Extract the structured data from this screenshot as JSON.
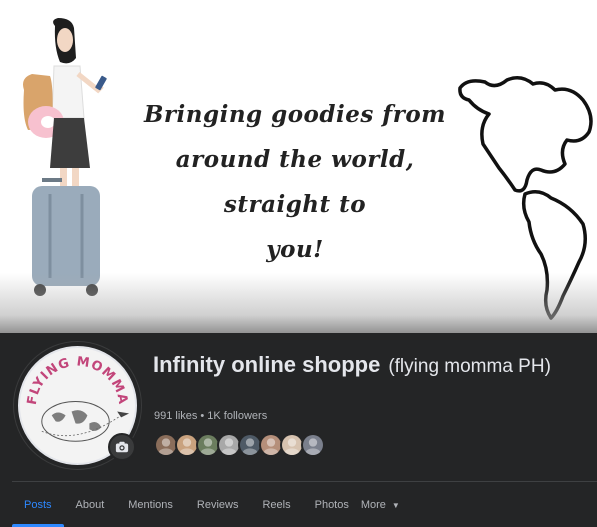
{
  "cover": {
    "tagline_lines": [
      "Bringing goodies from",
      "around the world, straight to",
      "you!"
    ]
  },
  "page": {
    "name": "Infinity online shoppe",
    "alt_name": "(flying momma PH)",
    "likes": "991 likes",
    "separator": "•",
    "followers": "1K followers"
  },
  "avatar": {
    "logo_text": "FLYING MOMMA"
  },
  "friends": {
    "colors": [
      "#8a6d5a",
      "#c9a27e",
      "#6b7d5e",
      "#a8a8a8",
      "#4e5a66",
      "#b58f7a",
      "#d7c3b0",
      "#7a7f8c"
    ]
  },
  "tabs": [
    {
      "label": "Posts",
      "active": true
    },
    {
      "label": "About"
    },
    {
      "label": "Mentions"
    },
    {
      "label": "Reviews"
    },
    {
      "label": "Reels"
    },
    {
      "label": "Photos"
    },
    {
      "label": "More"
    }
  ],
  "icons": {
    "camera": "camera-icon",
    "more_caret": "▼"
  },
  "colors": {
    "accent": "#2d88ff",
    "background": "#242526",
    "text_primary": "#e4e6eb",
    "text_secondary": "#b0b3b8"
  }
}
